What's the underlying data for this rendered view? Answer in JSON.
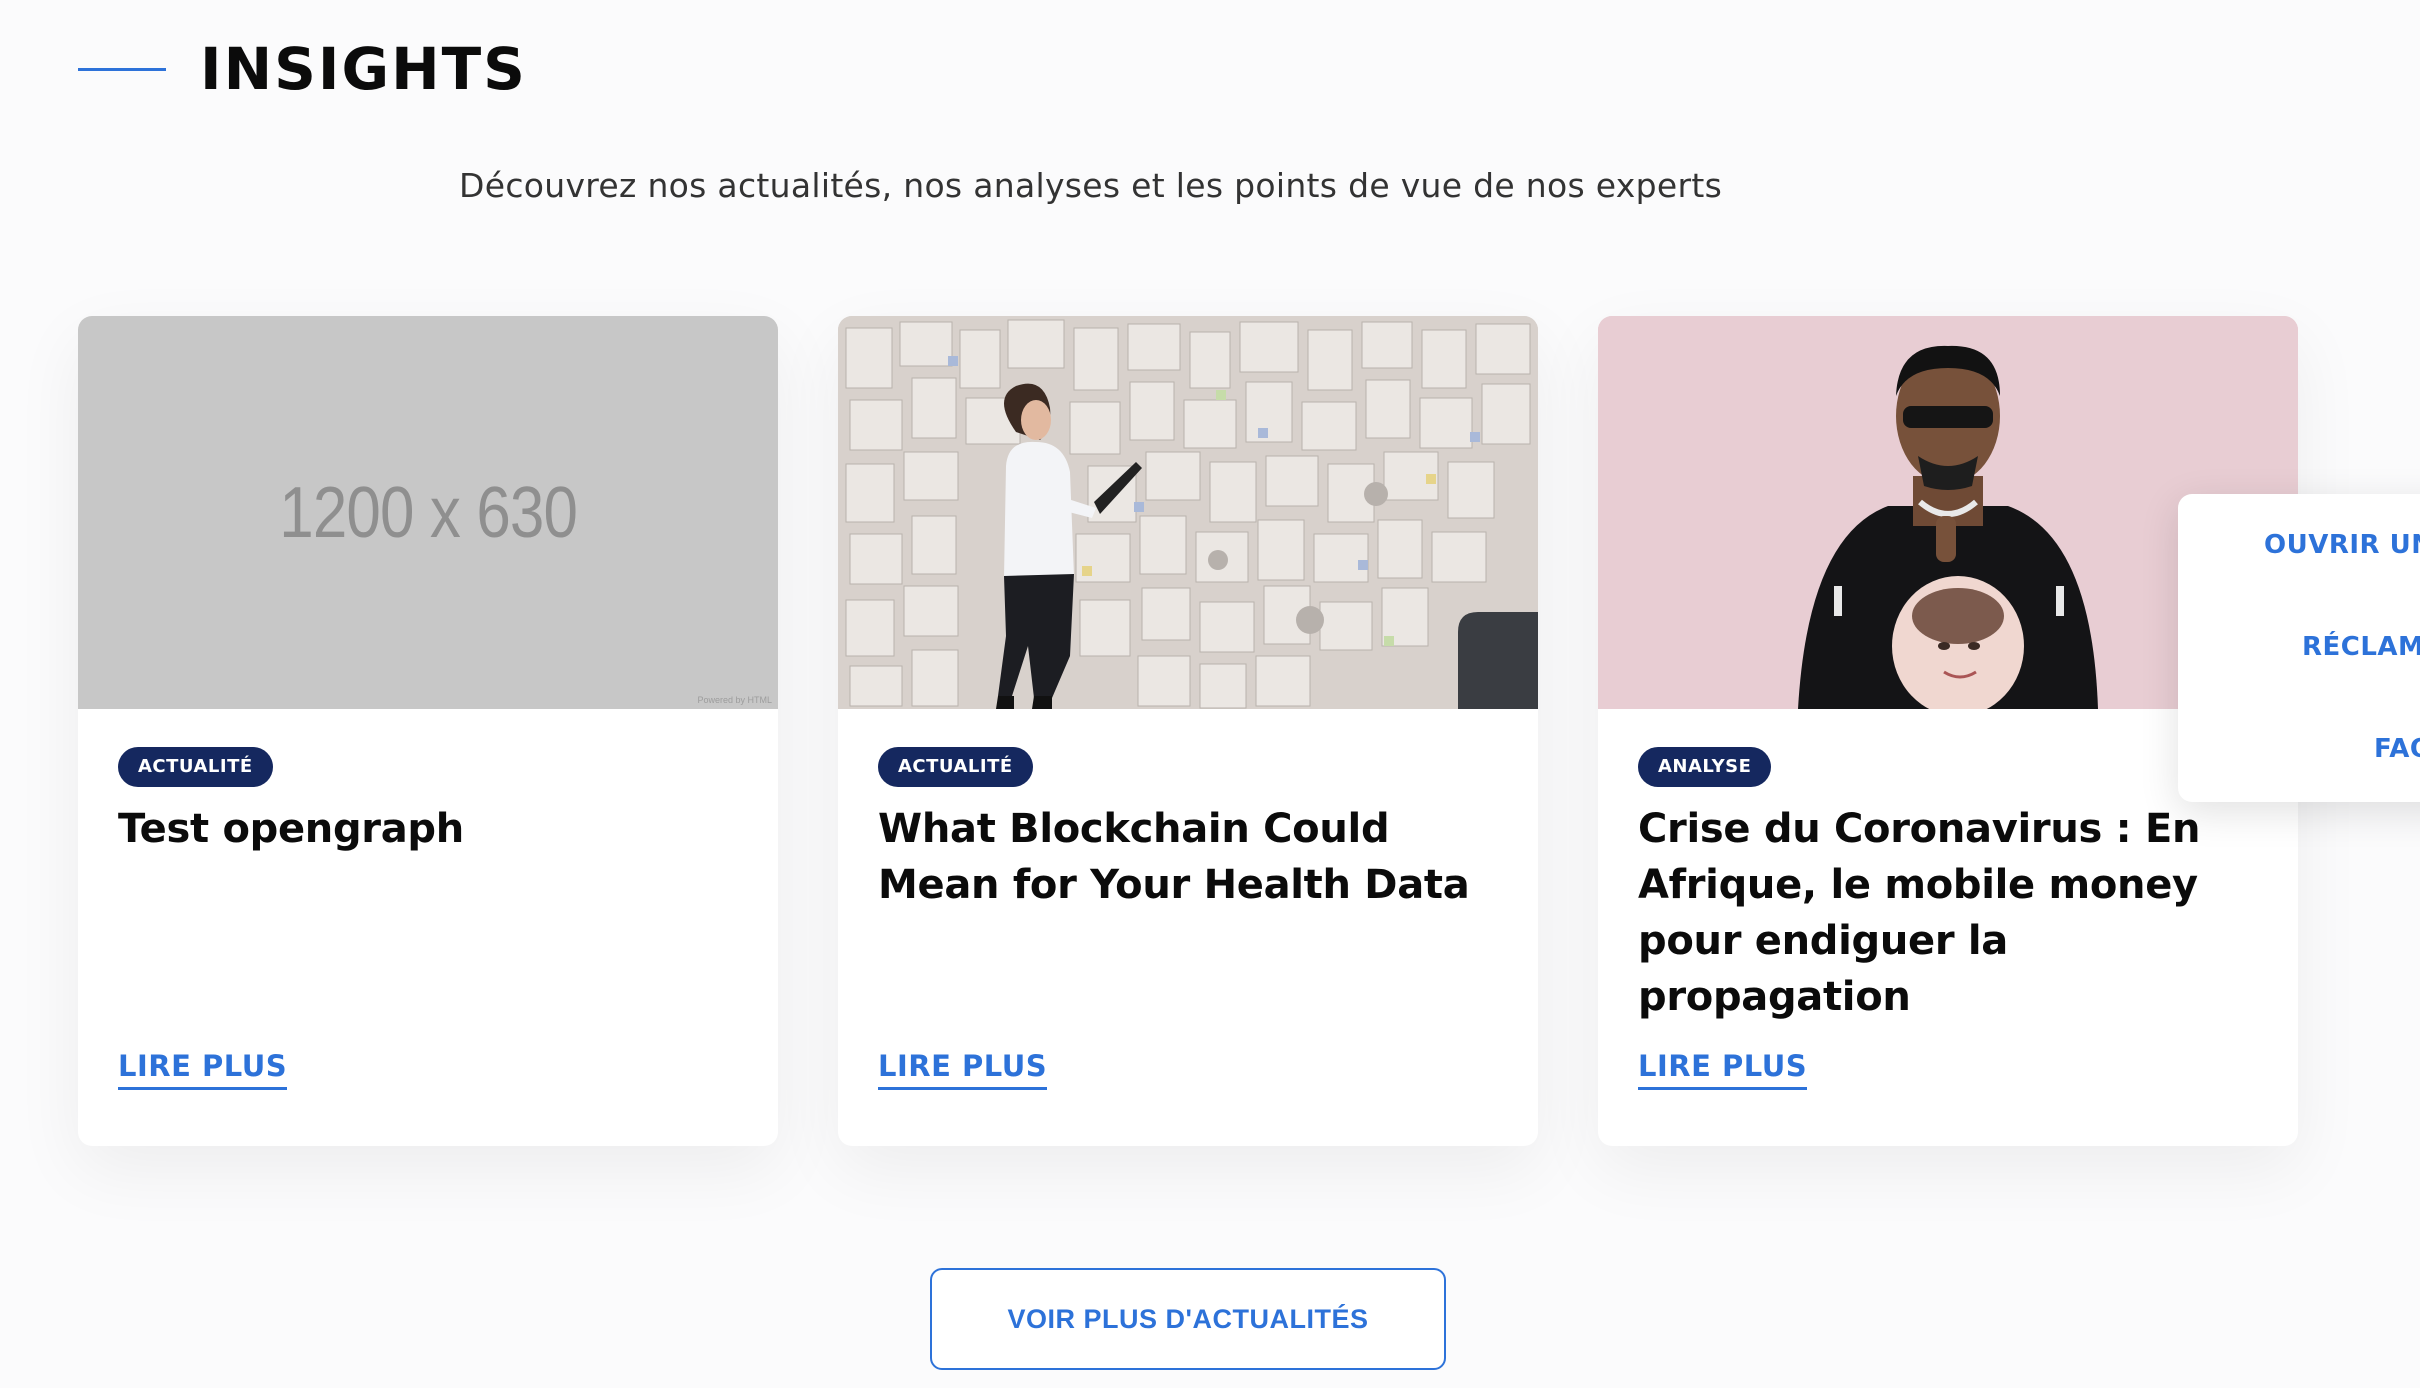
{
  "header": {
    "title": "INSIGHTS",
    "subtitle": "Découvrez nos actualités, nos analyses et les points de vue de nos experts"
  },
  "cards": [
    {
      "image_text": "1200 x 630",
      "image_caption": "Powered by HTML",
      "badge": "ACTUALITÉ",
      "title": "Test opengraph",
      "link": "LIRE PLUS"
    },
    {
      "badge": "ACTUALITÉ",
      "title": "What Blockchain Could Mean for Your Health Data",
      "link": "LIRE PLUS"
    },
    {
      "badge": "ANALYSE",
      "title": "Crise du Coronavirus : En Afrique, le mobile money pour endiguer la propagation",
      "link": "LIRE PLUS"
    }
  ],
  "more_button": "VOIR PLUS D'ACTUALITÉS",
  "floating_menu": {
    "items": [
      "OUVRIR UN",
      "RÉCLAMA",
      "FAQ"
    ]
  },
  "colors": {
    "accent": "#2d72d9",
    "badge": "#15285f"
  }
}
